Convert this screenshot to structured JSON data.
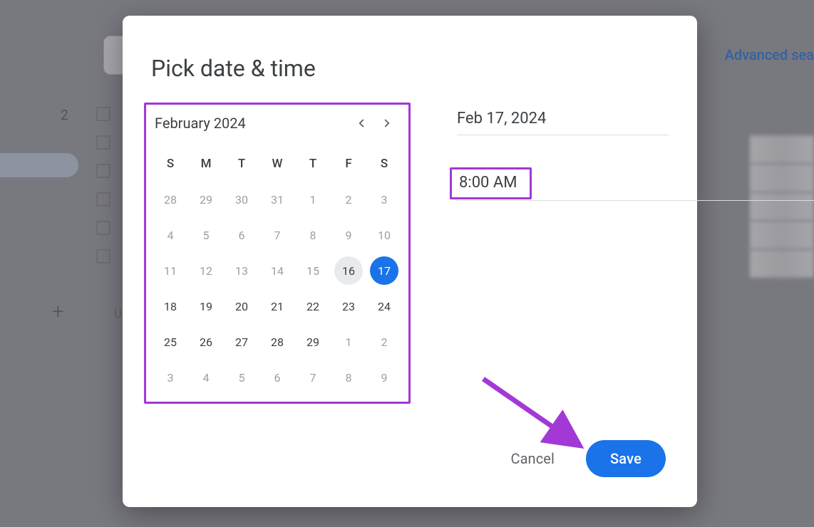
{
  "dialog": {
    "title": "Pick date & time",
    "selected_date": "Feb 17, 2024",
    "selected_time": "8:00 AM",
    "cancel_label": "Cancel",
    "save_label": "Save"
  },
  "calendar": {
    "month_label": "February 2024",
    "dow": [
      "S",
      "M",
      "T",
      "W",
      "T",
      "F",
      "S"
    ],
    "weeks": [
      [
        {
          "d": "28",
          "other": true
        },
        {
          "d": "29",
          "other": true
        },
        {
          "d": "30",
          "other": true
        },
        {
          "d": "31",
          "other": true
        },
        {
          "d": "1",
          "other": true
        },
        {
          "d": "2",
          "other": true
        },
        {
          "d": "3",
          "other": true
        }
      ],
      [
        {
          "d": "4",
          "other": true
        },
        {
          "d": "5",
          "other": true
        },
        {
          "d": "6",
          "other": true
        },
        {
          "d": "7",
          "other": true
        },
        {
          "d": "8",
          "other": true
        },
        {
          "d": "9",
          "other": true
        },
        {
          "d": "10",
          "other": true
        }
      ],
      [
        {
          "d": "11",
          "other": true
        },
        {
          "d": "12",
          "other": true
        },
        {
          "d": "13",
          "other": true
        },
        {
          "d": "14",
          "other": true
        },
        {
          "d": "15",
          "other": true
        },
        {
          "d": "16",
          "today": true
        },
        {
          "d": "17",
          "selected": true
        }
      ],
      [
        {
          "d": "18"
        },
        {
          "d": "19"
        },
        {
          "d": "20"
        },
        {
          "d": "21"
        },
        {
          "d": "22"
        },
        {
          "d": "23"
        },
        {
          "d": "24"
        }
      ],
      [
        {
          "d": "25"
        },
        {
          "d": "26"
        },
        {
          "d": "27"
        },
        {
          "d": "28"
        },
        {
          "d": "29"
        },
        {
          "d": "1",
          "other": true
        },
        {
          "d": "2",
          "other": true
        }
      ],
      [
        {
          "d": "3",
          "other": true
        },
        {
          "d": "4",
          "other": true
        },
        {
          "d": "5",
          "other": true
        },
        {
          "d": "6",
          "other": true
        },
        {
          "d": "7",
          "other": true
        },
        {
          "d": "8",
          "other": true
        },
        {
          "d": "9",
          "other": true
        }
      ]
    ]
  },
  "background": {
    "sidebar_count": "2",
    "advanced_search_label": "Advanced sea",
    "letter_u": "U"
  },
  "annotation": {
    "highlight_color": "#a238d6"
  }
}
